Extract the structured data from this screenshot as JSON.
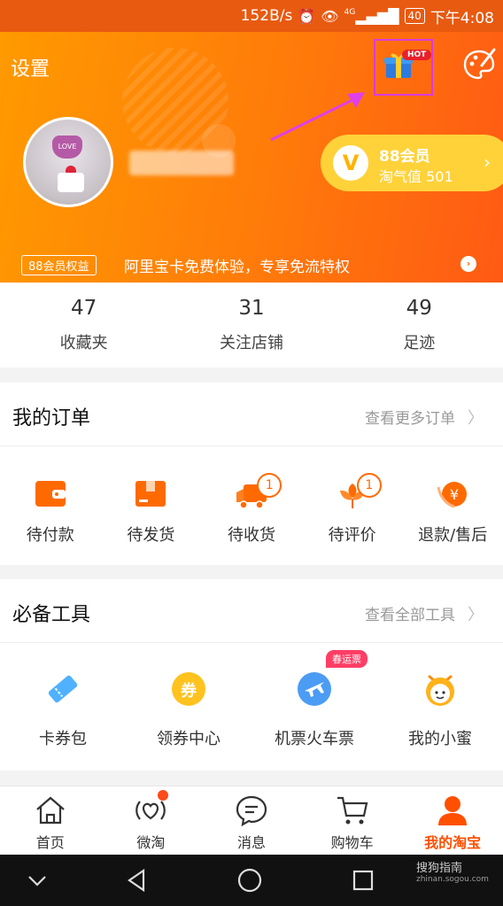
{
  "status_bar": {
    "speed": "152B/s",
    "network": "4G",
    "battery": "40",
    "time": "下午4:08"
  },
  "header": {
    "settings_label": "设置",
    "hot_badge": "HOT",
    "member": {
      "title": "88会员",
      "subtitle": "淘气值 501"
    },
    "benefit_badge": "88会员权益",
    "benefit_text": "阿里宝卡免费体验，专享免流特权",
    "colors": {
      "gradient_start": "#ff9a00",
      "gradient_end": "#ff5a14",
      "member_card": "#ffd23a"
    },
    "icons": [
      "gift-icon",
      "paint-palette-icon",
      "member-v-icon"
    ]
  },
  "stats": [
    {
      "value": "47",
      "label": "收藏夹"
    },
    {
      "value": "31",
      "label": "关注店铺"
    },
    {
      "value": "49",
      "label": "足迹"
    }
  ],
  "orders": {
    "title": "我的订单",
    "more": "查看更多订单",
    "items": [
      {
        "label": "待付款",
        "icon": "wallet-icon",
        "badge": ""
      },
      {
        "label": "待发货",
        "icon": "package-icon",
        "badge": ""
      },
      {
        "label": "待收货",
        "icon": "truck-icon",
        "badge": "1"
      },
      {
        "label": "待评价",
        "icon": "flower-icon",
        "badge": "1"
      },
      {
        "label": "退款/售后",
        "icon": "refund-icon",
        "badge": ""
      }
    ]
  },
  "tools": {
    "title": "必备工具",
    "more": "查看全部工具",
    "items": [
      {
        "label": "卡券包",
        "icon": "ticket-icon",
        "badge": ""
      },
      {
        "label": "领券中心",
        "icon": "coupon-icon",
        "glyph": "券",
        "badge": ""
      },
      {
        "label": "机票火车票",
        "icon": "plane-icon",
        "badge": "春运票"
      },
      {
        "label": "我的小蜜",
        "icon": "assistant-icon",
        "badge": ""
      }
    ]
  },
  "tabbar": {
    "items": [
      {
        "label": "首页",
        "icon": "home-icon"
      },
      {
        "label": "微淘",
        "icon": "weitao-icon"
      },
      {
        "label": "消息",
        "icon": "message-icon"
      },
      {
        "label": "购物车",
        "icon": "cart-icon"
      },
      {
        "label": "我的淘宝",
        "icon": "user-icon",
        "active": true
      }
    ],
    "accent": "#ff5000"
  },
  "watermark": {
    "brand": "搜狗指南",
    "url": "zhinan.sogou.com"
  }
}
